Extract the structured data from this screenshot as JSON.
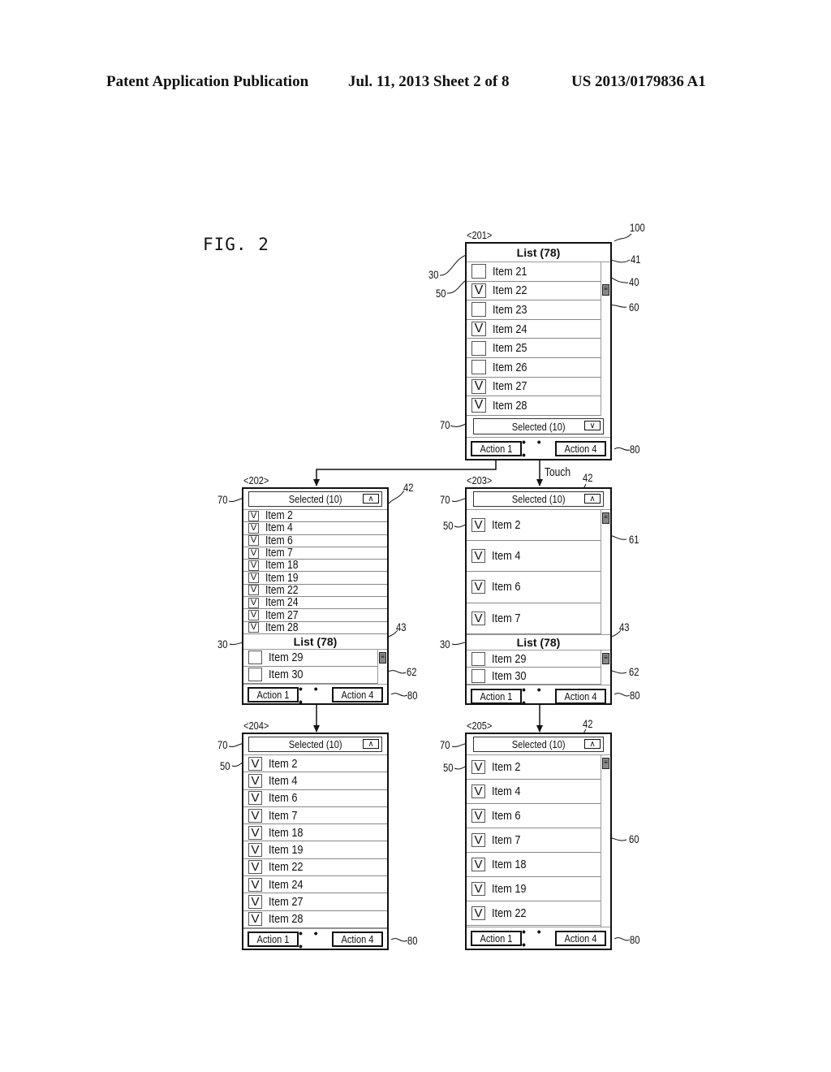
{
  "header": {
    "left": "Patent Application Publication",
    "middle": "Jul. 11, 2013   Sheet 2 of 8",
    "right": "US 2013/0179836 A1"
  },
  "figure_label": "FIG. 2",
  "transition_label": "Touch",
  "common": {
    "list_title": "List (78)",
    "selected_label": "Selected (10)",
    "action_left": "Action 1",
    "action_right": "Action 4",
    "dots": "• • •",
    "check_glyph": "V",
    "expand_icon": "chevron-down-icon",
    "collapse_icon": "chevron-up-icon"
  },
  "screens": {
    "s201": {
      "label": "<201>",
      "items": [
        {
          "label": "Item 21",
          "checked": false
        },
        {
          "label": "Item 22",
          "checked": true
        },
        {
          "label": "Item 23",
          "checked": false
        },
        {
          "label": "Item 24",
          "checked": true
        },
        {
          "label": "Item 25",
          "checked": false
        },
        {
          "label": "Item 26",
          "checked": false
        },
        {
          "label": "Item 27",
          "checked": true
        },
        {
          "label": "Item 28",
          "checked": true
        }
      ],
      "refs": {
        "r100": "100",
        "r41": "41",
        "r40": "40",
        "r60": "60",
        "r30": "30",
        "r50": "50",
        "r70": "70",
        "r80": "80"
      }
    },
    "s202": {
      "label": "<202>",
      "selected_items": [
        "Item 2",
        "Item 4",
        "Item 6",
        "Item 7",
        "Item 18",
        "Item 19",
        "Item 22",
        "Item 24",
        "Item 27",
        "Item 28"
      ],
      "list_items": [
        {
          "label": "Item 29",
          "checked": false
        },
        {
          "label": "Item 30",
          "checked": false
        }
      ],
      "refs": {
        "r70": "70",
        "r42": "42",
        "r43": "43",
        "r30": "30",
        "r62": "62",
        "r80": "80"
      }
    },
    "s203": {
      "label": "<203>",
      "selected_items": [
        "Item 2",
        "Item 4",
        "Item 6",
        "Item 7"
      ],
      "list_items": [
        {
          "label": "Item 29",
          "checked": false
        },
        {
          "label": "Item 30",
          "checked": false
        }
      ],
      "refs": {
        "r70": "70",
        "r42": "42",
        "r50": "50",
        "r61": "61",
        "r43": "43",
        "r30": "30",
        "r62": "62",
        "r80": "80"
      }
    },
    "s204": {
      "label": "<204>",
      "selected_items": [
        "Item 2",
        "Item 4",
        "Item 6",
        "Item 7",
        "Item 18",
        "Item 19",
        "Item 22",
        "Item 24",
        "Item 27",
        "Item 28"
      ],
      "refs": {
        "r70": "70",
        "r50": "50",
        "r80": "80"
      }
    },
    "s205": {
      "label": "<205>",
      "selected_items": [
        "Item 2",
        "Item 4",
        "Item 6",
        "Item 7",
        "Item 18",
        "Item 19",
        "Item 22"
      ],
      "refs": {
        "r42": "42",
        "r70": "70",
        "r50": "50",
        "r60": "60",
        "r80": "80"
      }
    }
  }
}
